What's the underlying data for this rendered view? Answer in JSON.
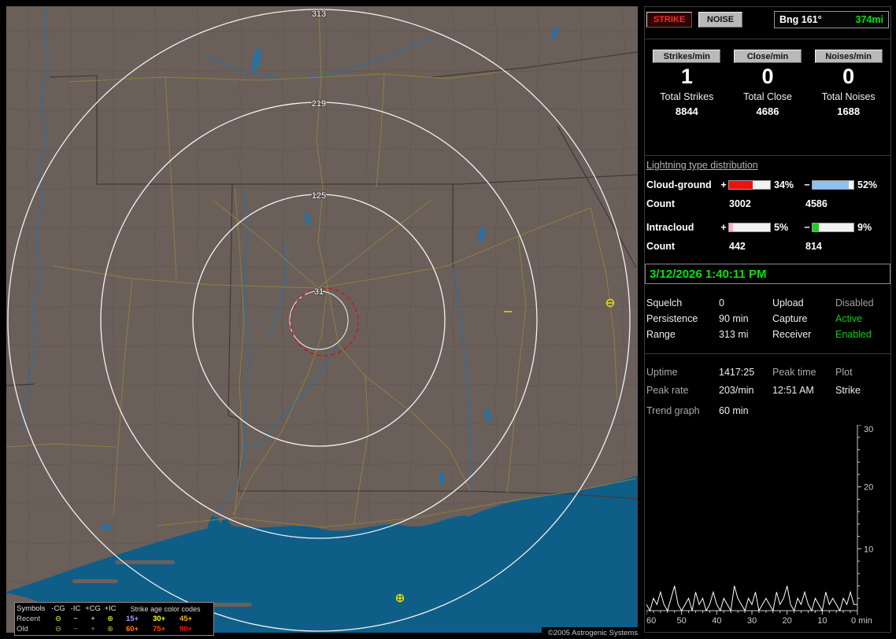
{
  "colors": {
    "green": "#00e400",
    "red": "#ff2a2a"
  },
  "map": {
    "ring_labels": [
      "313",
      "219",
      "125",
      "31"
    ],
    "copyright": "©2005 Astrogenic Systems",
    "legend": {
      "symbols_title": "Symbols",
      "col_headers": [
        "-CG",
        "-IC",
        "+CG",
        "+IC"
      ],
      "row_recent": "Recent",
      "row_old": "Old",
      "recent_symbols": [
        "⊖",
        "−",
        "+",
        "⊕"
      ],
      "old_symbols": [
        "⊖",
        "−",
        "+",
        "⊕"
      ],
      "age_title": "Strike age color codes",
      "age_row1": [
        {
          "label": "15+",
          "color": "#a0a0ff"
        },
        {
          "label": "30+",
          "color": "#ffff30"
        },
        {
          "label": "45+",
          "color": "#ffb000"
        }
      ],
      "age_row2": [
        {
          "label": "60+",
          "color": "#ff8000"
        },
        {
          "label": "75+",
          "color": "#ff4800"
        },
        {
          "label": "90+",
          "color": "#ff1010"
        }
      ]
    }
  },
  "panel": {
    "strike_button": "STRIKE",
    "noise_button": "NOISE",
    "bearing": {
      "label": "Bng 161°",
      "distance": "374mi"
    },
    "rate_columns": [
      {
        "button": "Strikes/min",
        "value": "1",
        "total_label": "Total Strikes",
        "total": "8844"
      },
      {
        "button": "Close/min",
        "value": "0",
        "total_label": "Total Close",
        "total": "4686"
      },
      {
        "button": "Noises/min",
        "value": "0",
        "total_label": "Total Noises",
        "total": "1688"
      }
    ],
    "distribution": {
      "title": "Lightning type distribution",
      "rows": [
        {
          "label": "Cloud-ground",
          "plus": "+",
          "minus": "−",
          "pos_pct": "34%",
          "neg_pct": "52%",
          "pos_fill": 58,
          "neg_fill": 88,
          "pos_color": "#ee1111",
          "neg_color": "#8fc1f0",
          "count_label": "Count",
          "pos_count": "3002",
          "neg_count": "4586"
        },
        {
          "label": "Intracloud",
          "plus": "+",
          "minus": "−",
          "pos_pct": "5%",
          "neg_pct": "9%",
          "pos_fill": 9,
          "neg_fill": 15,
          "pos_color": "#ffb0c8",
          "neg_color": "#22cc22",
          "count_label": "Count",
          "pos_count": "442",
          "neg_count": "814"
        }
      ]
    },
    "timestamp": "3/12/2026 1:40:11 PM",
    "settings": [
      {
        "label": "Squelch",
        "value": "0",
        "label2": "Upload",
        "value2": "Disabled",
        "value2_color": "#9f9f9f"
      },
      {
        "label": "Persistence",
        "value": "90 min",
        "label2": "Capture",
        "value2": "Active",
        "value2_color": "#00d200"
      },
      {
        "label": "Range",
        "value": "313 mi",
        "label2": "Receiver",
        "value2": "Enabled",
        "value2_color": "#00d200"
      }
    ],
    "stats": {
      "uptime_label": "Uptime",
      "uptime": "1417:25",
      "peak_time_label": "Peak time",
      "plot_label": "Plot",
      "peak_rate_label": "Peak rate",
      "peak_rate": "203/min",
      "peak_time": "12:51 AM",
      "plot": "Strike",
      "trend_label": "Trend graph",
      "trend_window": "60 min"
    }
  },
  "chart_data": {
    "type": "line",
    "x_unit": "min",
    "xlim": [
      60,
      0
    ],
    "ylim": [
      0,
      30
    ],
    "x_ticks": [
      60,
      50,
      40,
      30,
      20,
      10,
      0
    ],
    "y_ticks": [
      10,
      20,
      30
    ],
    "origin_label": "0 min",
    "values_per_min": [
      1,
      0,
      2,
      1,
      3,
      1,
      0,
      2,
      4,
      1,
      0,
      1,
      2,
      0,
      3,
      1,
      2,
      0,
      1,
      3,
      1,
      0,
      2,
      1,
      0,
      4,
      2,
      1,
      0,
      2,
      1,
      3,
      0,
      1,
      2,
      1,
      0,
      3,
      1,
      2,
      4,
      1,
      0,
      2,
      1,
      3,
      1,
      0,
      2,
      1,
      0,
      3,
      1,
      2,
      1,
      0,
      2,
      1,
      3,
      1,
      1
    ]
  }
}
